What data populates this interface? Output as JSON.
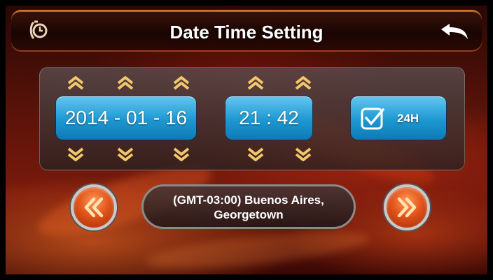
{
  "header": {
    "title": "Date Time Setting",
    "left_icon": "clock-settings-icon",
    "right_icon": "back-arrow-icon"
  },
  "date": {
    "value": "2014 - 01 - 16",
    "year": "2014",
    "month": "01",
    "day": "16"
  },
  "time": {
    "value": "21 : 42",
    "hour": "21",
    "minute": "42"
  },
  "format_24h": {
    "label": "24H",
    "checked": true
  },
  "timezone": {
    "line1": "(GMT-03:00) Buenos Aires,",
    "line2": "Georgetown"
  },
  "nav": {
    "prev_icon": "double-chevron-left-icon",
    "next_icon": "double-chevron-right-icon"
  },
  "colors": {
    "accent_blue": "#1d98d2",
    "chevron_gold": "#f2c86a",
    "nav_orange": "#e2541a"
  }
}
